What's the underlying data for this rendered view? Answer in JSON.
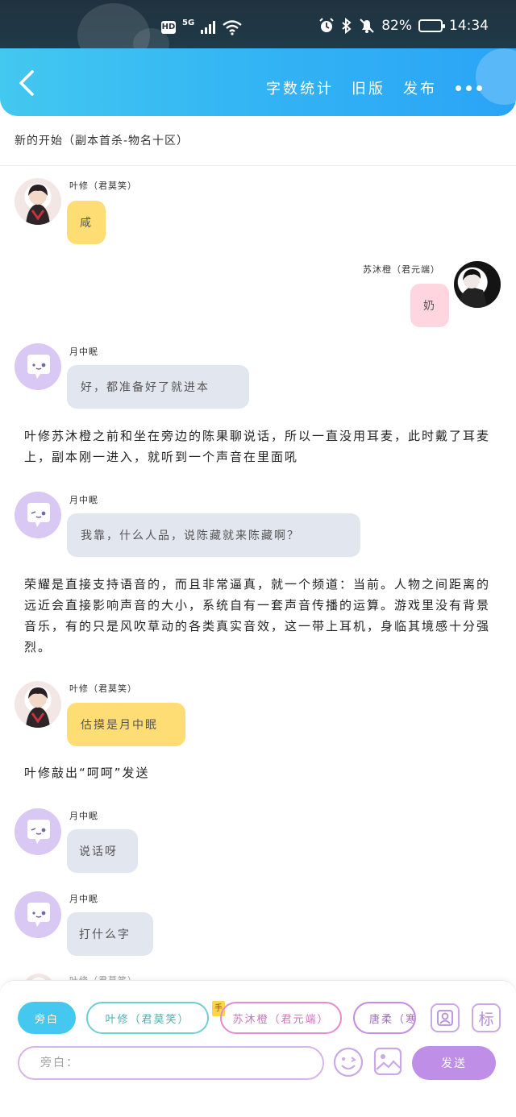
{
  "status_bar": {
    "hd": "HD",
    "network": "5G",
    "battery_percent": "82%",
    "time": "14:34",
    "battery_level": 0.82,
    "icons": [
      "alarm-icon",
      "bluetooth-icon",
      "mute-icon",
      "wifi-icon",
      "signal-icon"
    ]
  },
  "header": {
    "back_icon": "chevron-left-icon",
    "actions": [
      "字数统计",
      "旧版",
      "发布"
    ],
    "more_icon": "more-dots-icon",
    "gradient": [
      "#43c8f0",
      "#2aa4f6"
    ]
  },
  "chapter": {
    "title": "新的开始（副本首杀-物名十区）"
  },
  "messages": [
    {
      "type": "speech",
      "sender": "叶修（君莫笑）",
      "text": "咸",
      "side": "left",
      "avatar": "ye-xiu-avatar",
      "bubble_color": "#fede74"
    },
    {
      "type": "speech",
      "sender": "苏沐橙（君元端）",
      "text": "奶",
      "side": "right",
      "avatar": "su-avatar",
      "bubble_color": "#ffd6e0"
    },
    {
      "type": "speech",
      "sender": "月中眠",
      "text": "好，都准备好了就进本",
      "side": "left",
      "avatar": "ghost-avatar",
      "bubble_color": "#e2e6ef"
    },
    {
      "type": "narration",
      "text": "叶修苏沐橙之前和坐在旁边的陈果聊说话，所以一直没用耳麦，此时戴了耳麦上，副本刚一进入，就听到一个声音在里面吼"
    },
    {
      "type": "speech",
      "sender": "月中眠",
      "text": "我靠，什么人品，说陈藏就来陈藏啊？",
      "side": "left",
      "avatar": "ghost-avatar",
      "bubble_color": "#e2e6ef"
    },
    {
      "type": "narration",
      "text": "荣耀是直接支持语音的，而且非常逼真，就一个频道：当前。人物之间距离的远近会直接影响声音的大小，系统自有一套声音传播的运算。游戏里没有背景音乐，有的只是风吹草动的各类真实音效，这一带上耳机，身临其境感十分强烈。"
    },
    {
      "type": "speech",
      "sender": "叶修（君莫笑）",
      "text": "估摸是月中眠",
      "side": "left",
      "avatar": "ye-xiu-avatar",
      "bubble_color": "#fede74"
    },
    {
      "type": "narration",
      "text": "叶修敲出“呵呵”发送"
    },
    {
      "type": "speech",
      "sender": "月中眠",
      "text": "说话呀",
      "side": "left",
      "avatar": "ghost-avatar",
      "bubble_color": "#e2e6ef"
    },
    {
      "type": "speech",
      "sender": "月中眠",
      "text": "打什么字",
      "side": "left",
      "avatar": "ghost-avatar",
      "bubble_color": "#e2e6ef"
    }
  ],
  "partial_next_sender": "叶修（君莫笑）",
  "composer": {
    "role_chips": [
      "旁白",
      "叶修（君莫笑）",
      "苏沐橙（君元端）",
      "唐柔（寒"
    ],
    "selected_chip": "旁白",
    "chip_tag": "手",
    "placeholder": "旁白：",
    "send_label": "发送",
    "mark_label": "标",
    "icons": [
      "contact-card-icon",
      "mark-icon",
      "emoji-icon",
      "image-icon"
    ]
  }
}
